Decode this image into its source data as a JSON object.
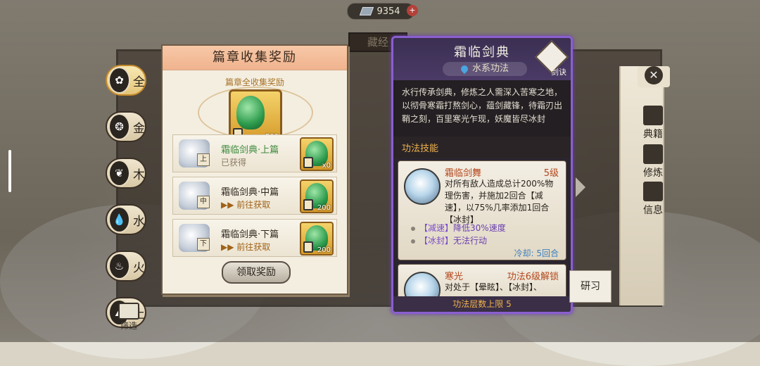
{
  "currency": {
    "value": "9354",
    "icon": "gem-icon"
  },
  "hall_sign": "藏经",
  "filters": [
    {
      "label": "全",
      "icon": "all-icon",
      "glyph": "✿"
    },
    {
      "label": "金",
      "icon": "metal-icon",
      "glyph": "❂"
    },
    {
      "label": "木",
      "icon": "wood-icon",
      "glyph": "❦"
    },
    {
      "label": "水",
      "icon": "water-icon",
      "glyph": "💧"
    },
    {
      "label": "火",
      "icon": "fire-icon",
      "glyph": "♨"
    },
    {
      "label": "土",
      "icon": "earth-icon",
      "glyph": "⛰"
    }
  ],
  "filter_button": "筛选",
  "collection": {
    "title": "篇章收集奖励",
    "all_reward_title": "篇章全收集奖励",
    "all_reward_count": "500",
    "rows": [
      {
        "name": "霜临剑典·上篇",
        "status": "已获得",
        "tag": "上",
        "count": "x0"
      },
      {
        "name": "霜临剑典·中篇",
        "status": "前往获取",
        "tag": "中",
        "count": "200"
      },
      {
        "name": "霜临剑典·下篇",
        "status": "前往获取",
        "tag": "下",
        "count": "200"
      }
    ],
    "claim_label": "领取奖励"
  },
  "skill_panel": {
    "title": "霜临剑典",
    "type": "水系功法",
    "badge": "剑诀",
    "description": "水行传承剑典，修炼之人需深入苦寒之地，以彻骨寒霜打熬剑心，蕴剑藏锋，待霜刃出鞘之刻，百里寒光乍现，妖魔皆尽冰封",
    "section_title": "功法技能",
    "skills": [
      {
        "name": "霜临剑舞",
        "level": "5级",
        "text": "对所有敌人造成总计200%物理伤害，并施加2回合【减速】，以75%几率添加1回合【冰封】",
        "buffs": [
          {
            "tag": "【减速】",
            "desc": "降低30%速度"
          },
          {
            "tag": "【冰封】",
            "desc": "无法行动"
          }
        ],
        "cooldown": "冷却:  5回合"
      },
      {
        "name": "寒光",
        "level": "功法6级解锁",
        "text": "对处于【晕眩】、【冰封】、"
      }
    ],
    "layer_limit": "功法层数上限 5"
  },
  "study_button": "研习",
  "side_menu": [
    {
      "label": "典籍",
      "icon": "book-icon"
    },
    {
      "label": "修炼",
      "icon": "meditate-icon"
    },
    {
      "label": "信息",
      "icon": "info-icon"
    }
  ]
}
